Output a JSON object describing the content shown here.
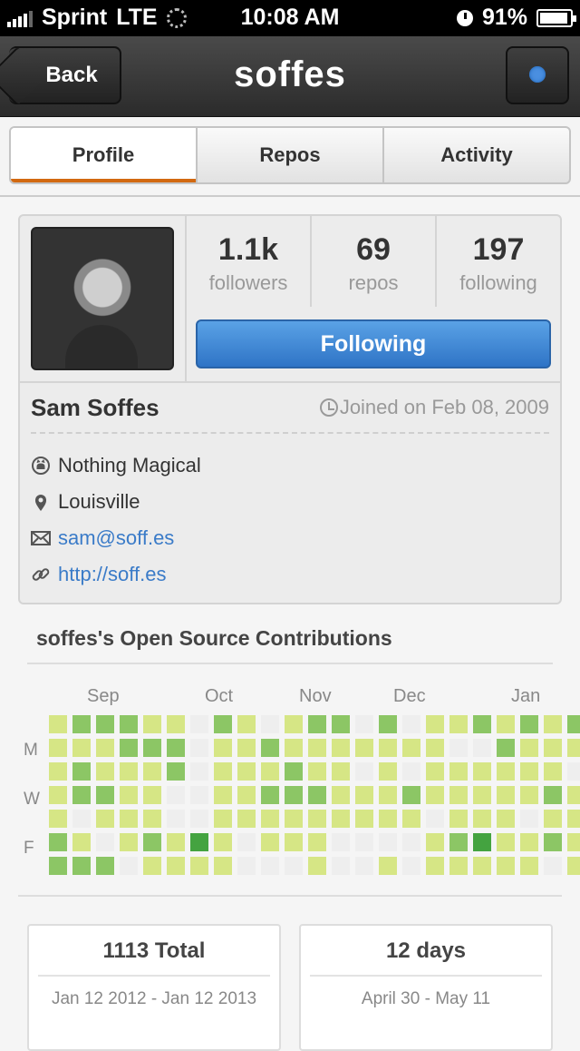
{
  "status": {
    "carrier": "Sprint",
    "network": "LTE",
    "time": "10:08 AM",
    "battery": "91%"
  },
  "nav": {
    "back_label": "Back",
    "title": "soffes"
  },
  "tabs": [
    {
      "label": "Profile",
      "active": true
    },
    {
      "label": "Repos",
      "active": false
    },
    {
      "label": "Activity",
      "active": false
    }
  ],
  "profile": {
    "stats": [
      {
        "value": "1.1k",
        "label": "followers"
      },
      {
        "value": "69",
        "label": "repos"
      },
      {
        "value": "197",
        "label": "following"
      }
    ],
    "follow_button": "Following",
    "name": "Sam Soffes",
    "joined": "Joined on Feb 08, 2009",
    "company": "Nothing Magical",
    "location": "Louisville",
    "email": "sam@soff.es",
    "website": "http://soff.es"
  },
  "contributions": {
    "title": "soffes's Open Source Contributions",
    "months": [
      "Sep",
      "Oct",
      "Nov",
      "Dec",
      "Jan"
    ],
    "day_labels": [
      "M",
      "W",
      "F"
    ],
    "colors": {
      "0": "#eeeeee",
      "1": "#d6e685",
      "2": "#8cc665",
      "3": "#44a340",
      "4": "#1e6823"
    },
    "grid": [
      "122211021012202011212122",
      "111222011211111110021111",
      "121112011121101011111101",
      "122110011222111211111211",
      "101110011111111101110111",
      "210121310111000012311211",
      "222011110001001011111011"
    ]
  },
  "summary": [
    {
      "title": "1113 Total",
      "subtitle": "Jan 12 2012 - Jan 12 2013"
    },
    {
      "title": "12 days",
      "subtitle": "April 30 - May 11"
    }
  ]
}
